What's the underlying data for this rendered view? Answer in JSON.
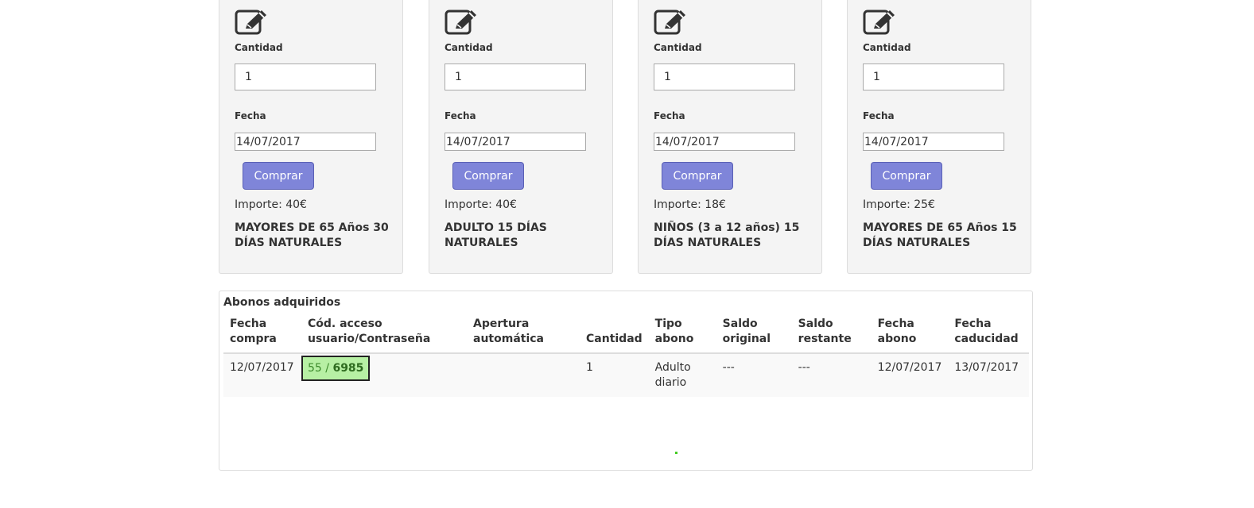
{
  "labels": {
    "quantity": "Cantidad",
    "date": "Fecha",
    "buy": "Comprar"
  },
  "cards": [
    {
      "quantity": "1",
      "date": "14/07/2017",
      "price": "Importe: 40€",
      "name": "MAYORES DE 65 Años 30 DÍAS NATURALES"
    },
    {
      "quantity": "1",
      "date": "14/07/2017",
      "price": "Importe: 40€",
      "name": "ADULTO 15 DÍAS NATURALES"
    },
    {
      "quantity": "1",
      "date": "14/07/2017",
      "price": "Importe: 18€",
      "name": "NIÑOS (3 a 12 años) 15 DÍAS NATURALES"
    },
    {
      "quantity": "1",
      "date": "14/07/2017",
      "price": "Importe: 25€",
      "name": "MAYORES DE 65 Años 15 DÍAS NATURALES"
    }
  ],
  "purchases": {
    "title": "Abonos adquiridos",
    "columns": [
      "Fecha compra",
      "Cód. acceso usuario/Contraseña",
      "Apertura automática",
      "Cantidad",
      "Tipo abono",
      "Saldo original",
      "Saldo restante",
      "Fecha abono",
      "Fecha caducidad"
    ],
    "rows": [
      {
        "purchase_date": "12/07/2017",
        "access_user": "55",
        "access_sep": " / ",
        "access_password": "6985",
        "auto_open": "",
        "quantity": "1",
        "type": "Adulto diario",
        "original_balance": "---",
        "remaining_balance": "---",
        "pass_date": "12/07/2017",
        "expiry_date": "13/07/2017"
      }
    ]
  },
  "colors": {
    "button": "#7f85d9",
    "card_bg": "#f4f4f4",
    "code_bg": "#b7f0a4",
    "dot": "#44cc22"
  }
}
